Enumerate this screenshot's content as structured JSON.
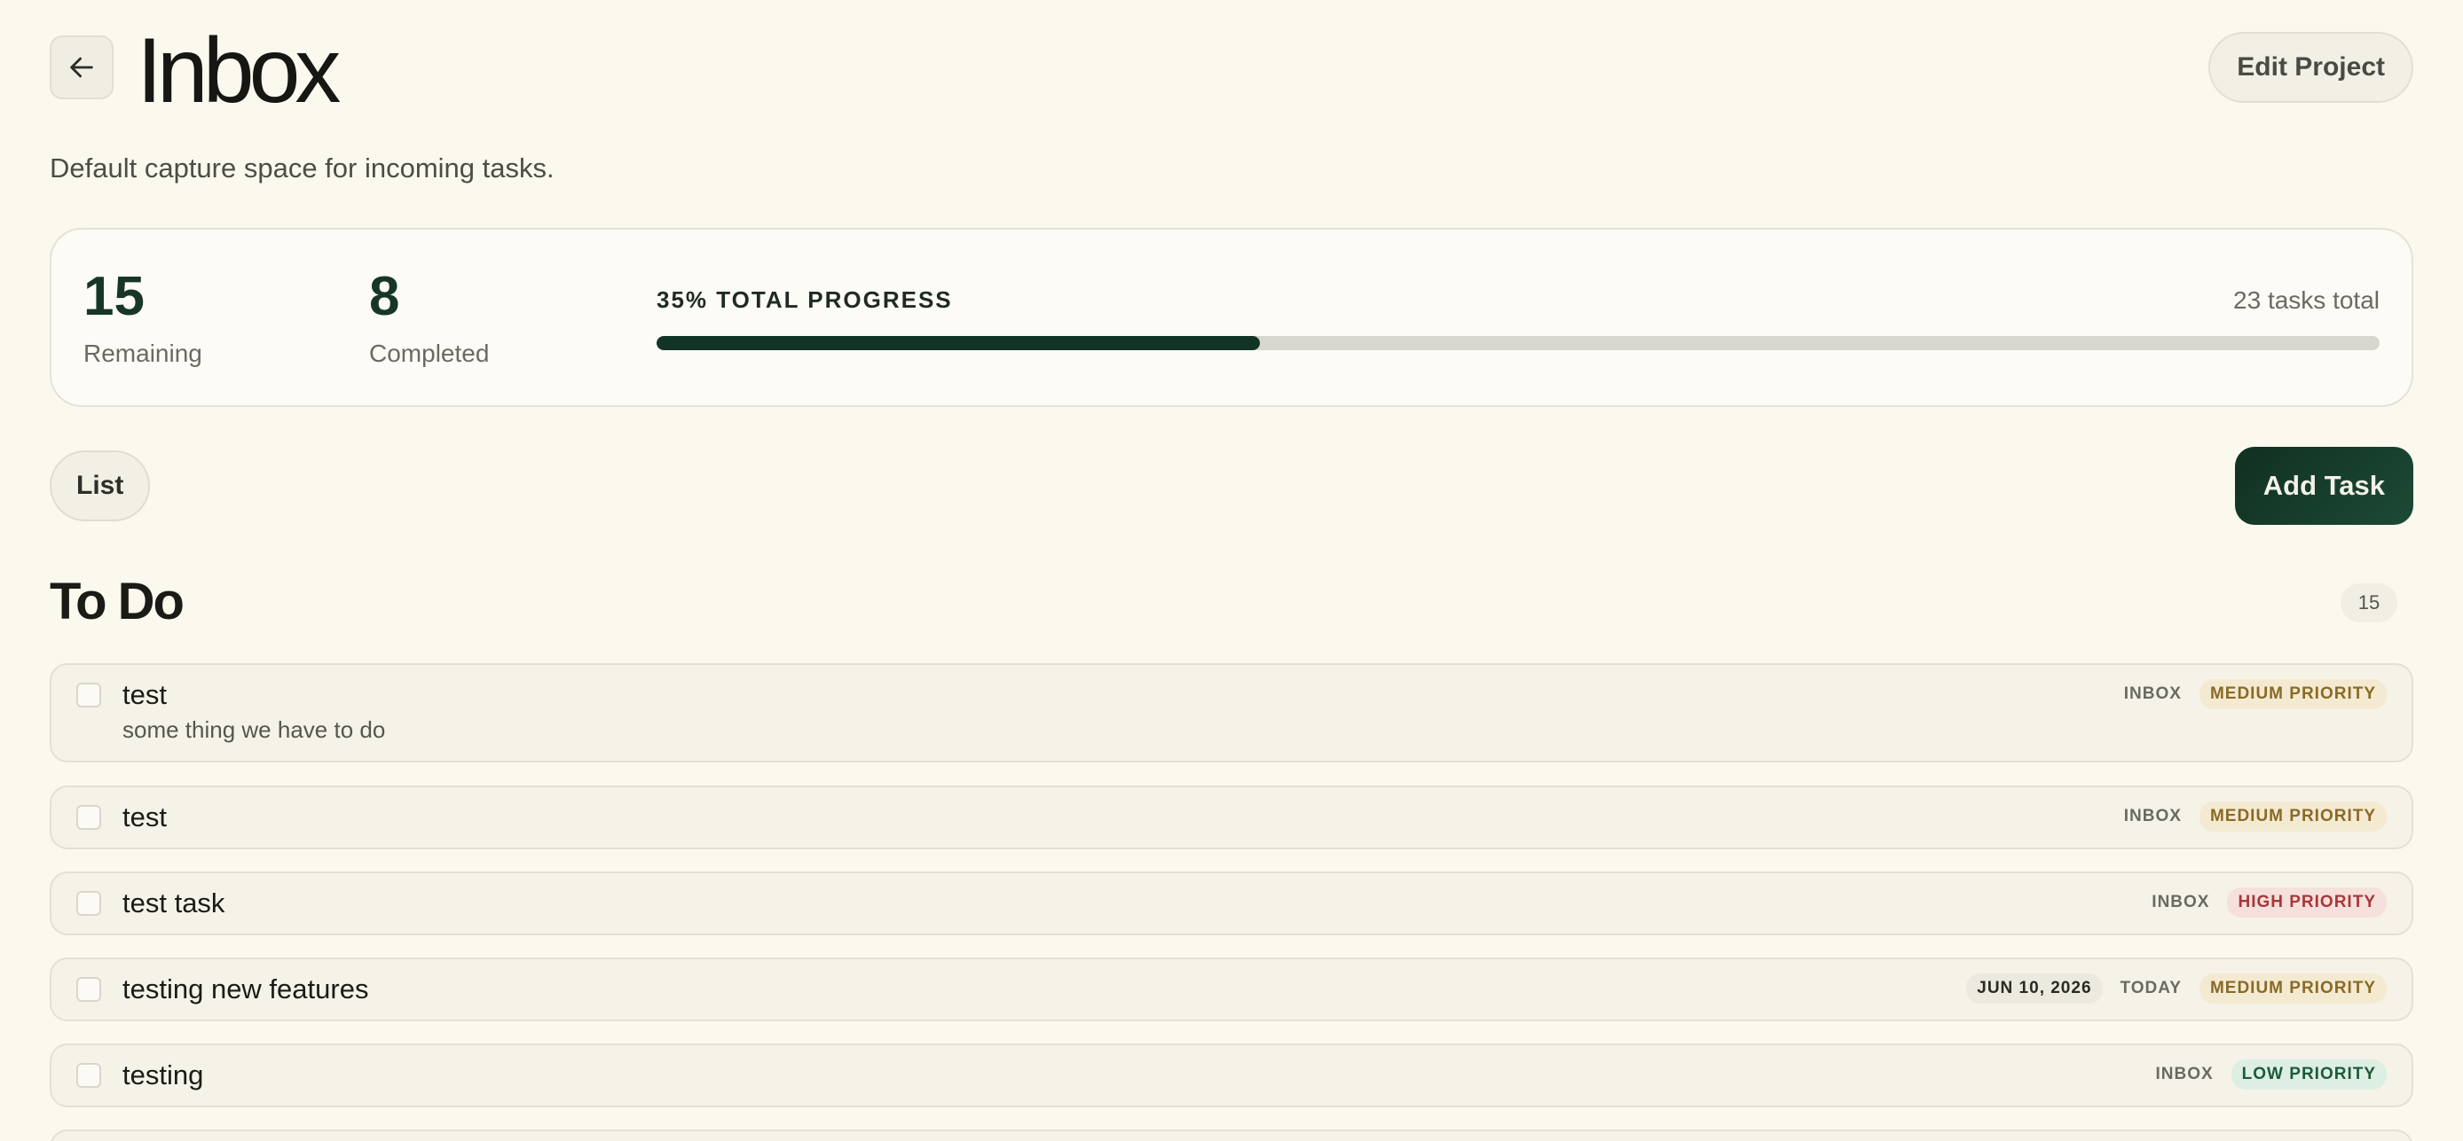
{
  "header": {
    "title": "Inbox",
    "subtitle": "Default capture space for incoming tasks.",
    "edit_label": "Edit Project"
  },
  "stats": {
    "remaining": "15",
    "remaining_label": "Remaining",
    "completed": "8",
    "completed_label": "Completed",
    "progress_label": "35% TOTAL PROGRESS",
    "progress_value": 0.35,
    "total_label": "23 tasks total"
  },
  "toolbar": {
    "view_label": "List",
    "add_label": "Add Task"
  },
  "section": {
    "title": "To Do",
    "count": "15"
  },
  "tasks": [
    {
      "title": "test",
      "description": "some thing we have to do",
      "project": "INBOX",
      "priority": "MEDIUM PRIORITY",
      "priority_level": "medium"
    },
    {
      "title": "test",
      "project": "INBOX",
      "priority": "MEDIUM PRIORITY",
      "priority_level": "medium"
    },
    {
      "title": "test task",
      "project": "INBOX",
      "priority": "HIGH PRIORITY",
      "priority_level": "high"
    },
    {
      "title": "testing new features",
      "due_date": "JUN 10, 2026",
      "project": "TODAY",
      "priority": "MEDIUM PRIORITY",
      "priority_level": "medium"
    },
    {
      "title": "testing",
      "project": "INBOX",
      "priority": "LOW PRIORITY",
      "priority_level": "low"
    }
  ],
  "colors": {
    "background": "#fbf9ee",
    "accent": "#123426",
    "medium": "#8a6a25",
    "high": "#a83838",
    "low": "#1e5a3a"
  }
}
